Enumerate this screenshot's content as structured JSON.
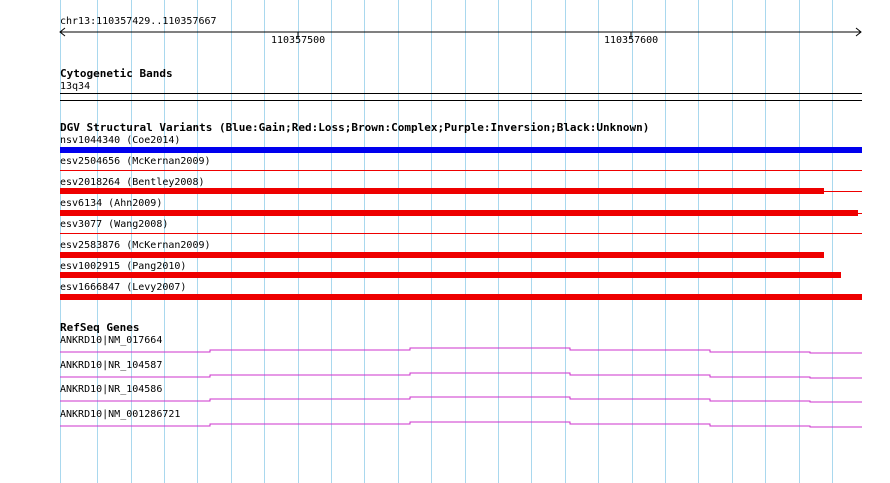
{
  "ruler": {
    "title": "chr13:110357429..110357667",
    "ticks": [
      "110357500",
      "110357600"
    ]
  },
  "cytoband": {
    "title": "Cytogenetic Bands",
    "band": "13q34"
  },
  "dgv": {
    "title": "DGV Structural Variants (Blue:Gain;Red:Loss;Brown:Complex;Purple:Inversion;Black:Unknown)",
    "variants": [
      {
        "label": "nsv1044340 (Coe2014)",
        "color": "#0000ee"
      },
      {
        "label": "esv2504656 (McKernan2009)",
        "color": "#ee0000"
      },
      {
        "label": "esv2018264 (Bentley2008)",
        "color": "#ee0000"
      },
      {
        "label": "esv6134 (Ahn2009)",
        "color": "#ee0000"
      },
      {
        "label": "esv3077 (Wang2008)",
        "color": "#ee0000"
      },
      {
        "label": "esv2583876 (McKernan2009)",
        "color": "#ee0000"
      },
      {
        "label": "esv1002915 (Pang2010)",
        "color": "#ee0000"
      },
      {
        "label": "esv1666847 (Levy2007)",
        "color": "#ee0000"
      }
    ]
  },
  "refseq": {
    "title": "RefSeq Genes",
    "genes": [
      {
        "label": "ANKRD10|NM_017664",
        "color": "#cc33cc"
      },
      {
        "label": "ANKRD10|NR_104587",
        "color": "#cc33cc"
      },
      {
        "label": "ANKRD10|NR_104586",
        "color": "#cc33cc"
      },
      {
        "label": "ANKRD10|NM_001286721",
        "color": "#cc33cc"
      }
    ]
  }
}
